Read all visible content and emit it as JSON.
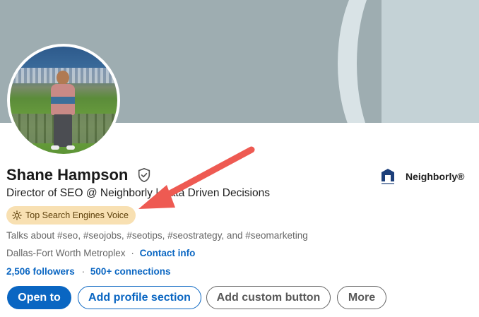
{
  "profile": {
    "name": "Shane Hampson",
    "headline": "Director of SEO @ Neighborly | Data Driven Decisions",
    "badge_label": "Top Search Engines Voice",
    "talks_about": "Talks about #seo, #seojobs, #seotips, #seostrategy, and #seomarketing",
    "location": "Dallas-Fort Worth Metroplex",
    "location_separator": "·",
    "contact_info": "Contact info",
    "followers": "2,506 followers",
    "followers_separator": "·",
    "connections": "500+ connections"
  },
  "company": {
    "name": "Neighborly®",
    "logo_icon": "neighborly-logo-icon"
  },
  "actions": {
    "open_to": "Open to",
    "add_profile_section": "Add profile section",
    "add_custom_button": "Add custom button",
    "more": "More"
  },
  "icons": {
    "verified": "verified-shield-icon",
    "badge": "sun-icon"
  },
  "colors": {
    "accent": "#0a66c2",
    "badge_bg": "#f8e0b2",
    "annotation_arrow": "#ee5a52",
    "banner": "#9eadb1"
  }
}
